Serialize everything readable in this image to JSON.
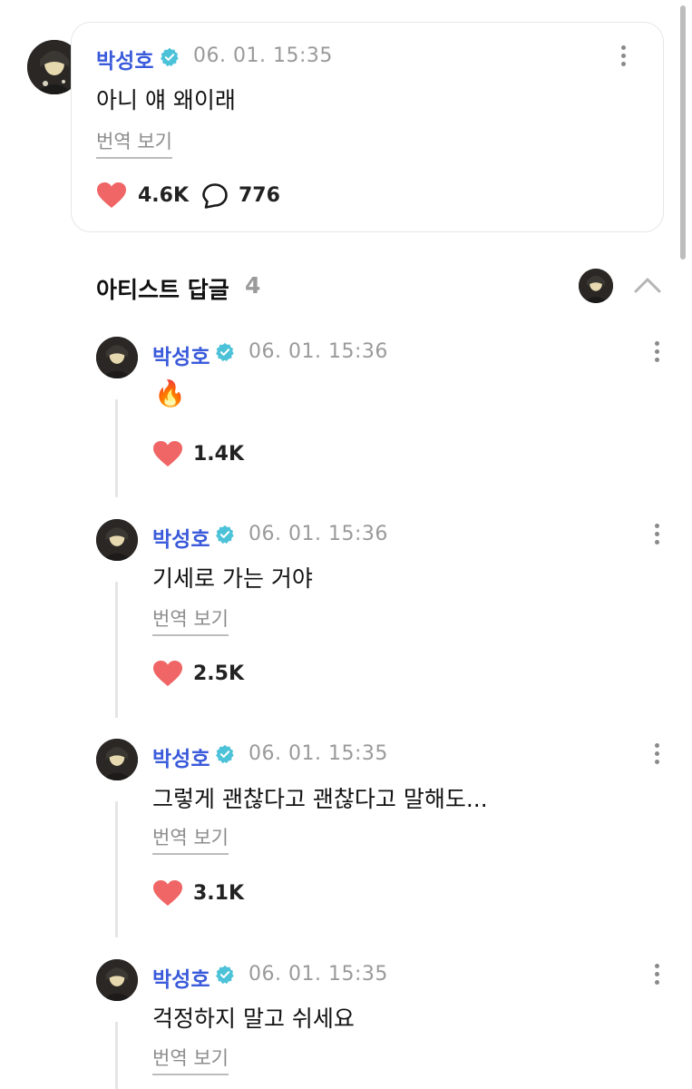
{
  "post": {
    "author": "박성호",
    "time": "06. 01. 15:35",
    "text": "아니 얘 왜이래",
    "translate_label": "번역 보기",
    "likes": "4.6K",
    "comments": "776"
  },
  "replies_section": {
    "title": "아티스트 답글",
    "count": "4"
  },
  "replies": [
    {
      "author": "박성호",
      "time": "06. 01. 15:36",
      "text": "🔥",
      "likes": "1.4K"
    },
    {
      "author": "박성호",
      "time": "06. 01. 15:36",
      "text": "기세로 가는 거야",
      "translate_label": "번역 보기",
      "likes": "2.5K"
    },
    {
      "author": "박성호",
      "time": "06. 01. 15:35",
      "text": "그렇게 괜찮다고 괜찮다고 말해도...",
      "translate_label": "번역 보기",
      "likes": "3.1K"
    },
    {
      "author": "박성호",
      "time": "06. 01. 15:35",
      "text": "걱정하지 말고 쉬세요",
      "translate_label": "번역 보기"
    }
  ],
  "colors": {
    "author": "#3b5bdb",
    "verified": "#4cc2d8",
    "heart": "#f06565"
  },
  "icons": [
    "verified-badge-icon",
    "more-vertical-icon",
    "heart-icon",
    "comment-bubble-icon",
    "chevron-up-icon",
    "fire-emoji"
  ]
}
